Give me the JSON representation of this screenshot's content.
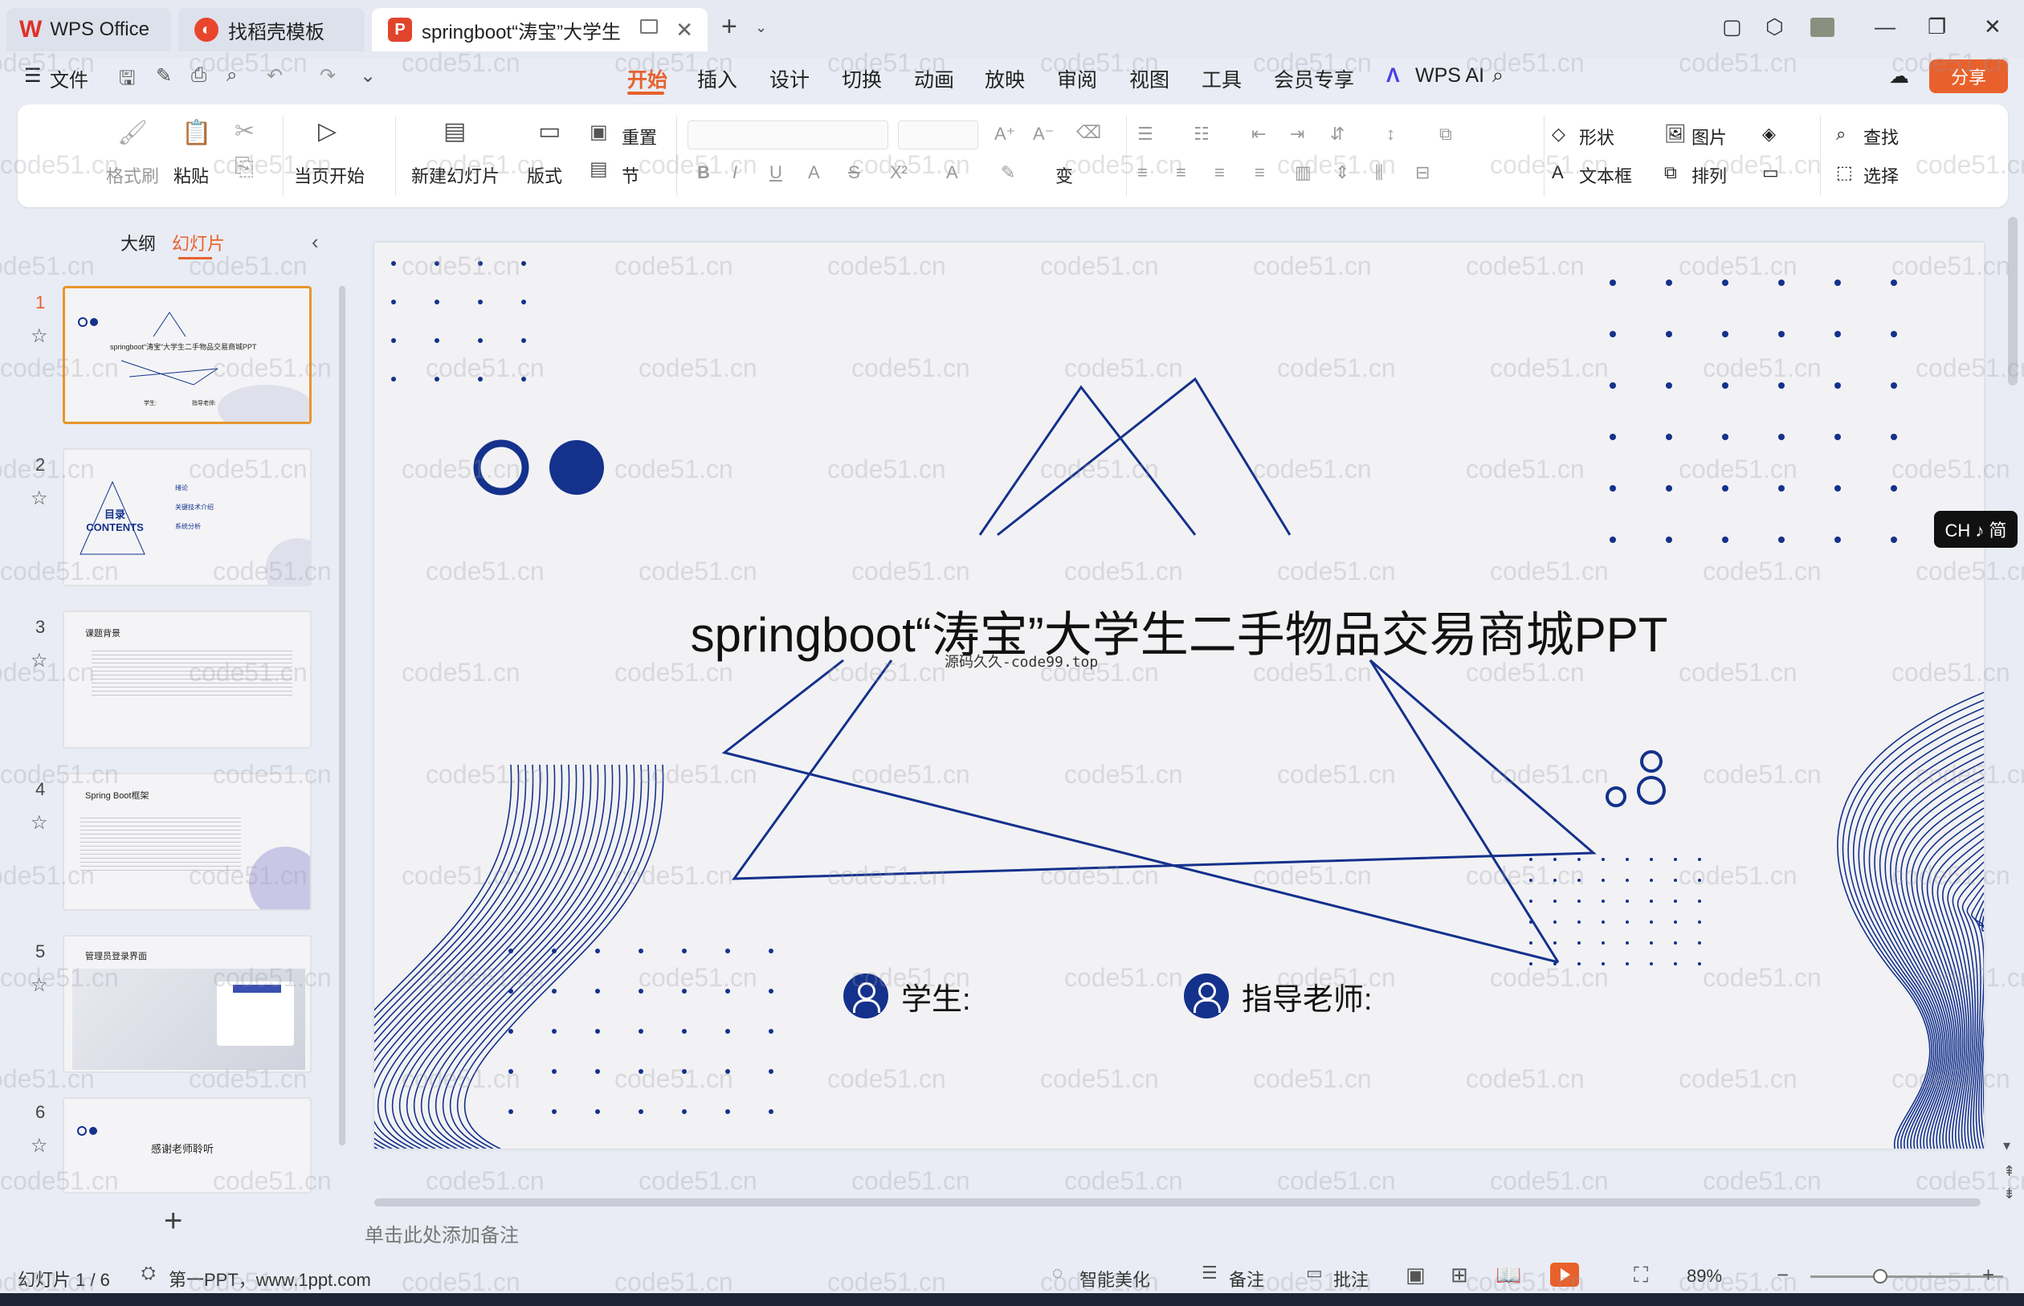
{
  "tabs": {
    "wps": "WPS Office",
    "template": "找稻壳模板",
    "doc": "springboot“涛宝”大学生"
  },
  "menu": {
    "file": "文件",
    "items": [
      "开始",
      "插入",
      "设计",
      "切换",
      "动画",
      "放映",
      "审阅",
      "视图",
      "工具",
      "会员专享"
    ],
    "active": "开始",
    "wps_ai": "WPS AI",
    "share": "分享"
  },
  "ribbon": {
    "format_painter": "格式刷",
    "paste": "粘贴",
    "start_from_current": "当页开始",
    "new_slide": "新建幻灯片",
    "layout": "版式",
    "reset": "重置",
    "section": "节",
    "shape": "形状",
    "picture": "图片",
    "find": "查找",
    "textbox": "文本框",
    "arrange": "排列",
    "select": "选择"
  },
  "left_panel": {
    "outline_tab": "大纲",
    "slides_tab": "幻灯片",
    "thumbs": [
      {
        "num": "1",
        "title": "springboot“涛宝”大学生二手物品交易商城PPT",
        "s1": "学生:",
        "s2": "指导老师:"
      },
      {
        "num": "2",
        "title": "目录 CONTENTS",
        "i1": "绪论",
        "i2": "关键技术介绍",
        "i3": "系统分析"
      },
      {
        "num": "3",
        "title": "课题背景"
      },
      {
        "num": "4",
        "title": "Spring Boot框架"
      },
      {
        "num": "5",
        "title": "管理员登录界面"
      },
      {
        "num": "6",
        "title": "感谢老师聆听"
      }
    ]
  },
  "slide": {
    "title": "springboot“涛宝”大学生二手物品交易商城PPT",
    "subtitle": "源码久久-code99.top",
    "student_label": "学生:",
    "teacher_label": "指导老师:"
  },
  "notes": {
    "placeholder": "单击此处添加备注"
  },
  "status": {
    "slide_counter": "幻灯片 1 / 6",
    "theme": "第一PPT，www.1ppt.com",
    "beautify": "智能美化",
    "notes": "备注",
    "comment": "批注",
    "zoom": "89%"
  },
  "ime": "CH ♪ 简",
  "watermark": "code51.cn",
  "colors": {
    "accent": "#e8612c",
    "slide_blue": "#14318c"
  }
}
